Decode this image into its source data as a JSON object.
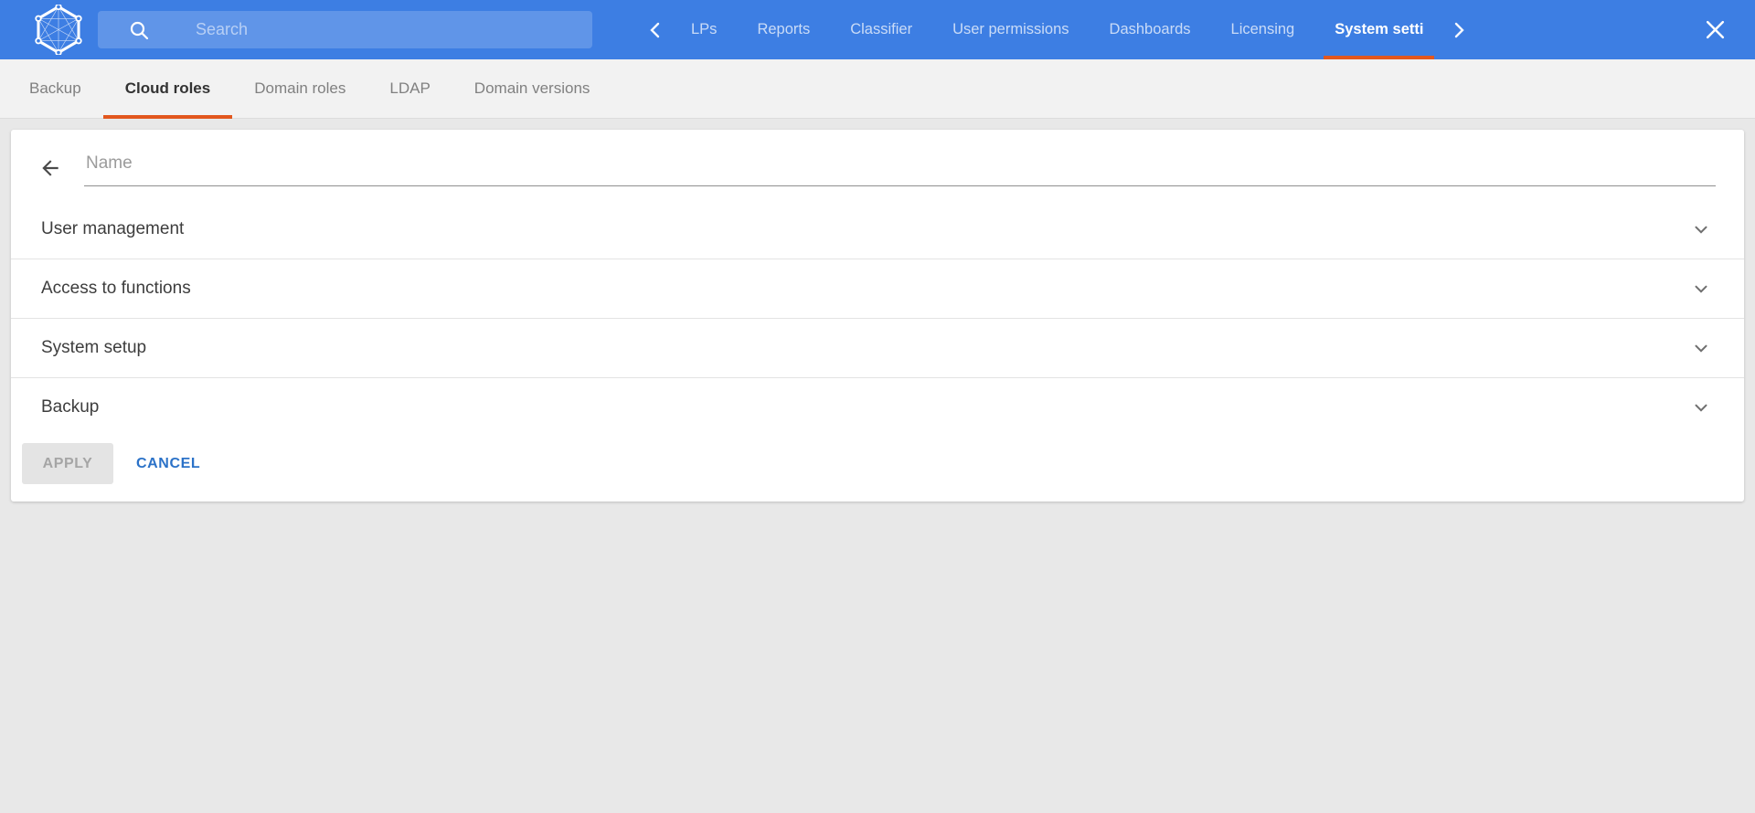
{
  "topbar": {
    "search": {
      "placeholder": "Search",
      "value": ""
    },
    "nav_items": [
      {
        "label": "LPs",
        "active": false
      },
      {
        "label": "Reports",
        "active": false
      },
      {
        "label": "Classifier",
        "active": false
      },
      {
        "label": "User permissions",
        "active": false
      },
      {
        "label": "Dashboards",
        "active": false
      },
      {
        "label": "Licensing",
        "active": false
      },
      {
        "label": "System setti",
        "active": true
      }
    ]
  },
  "subtabs": {
    "items": [
      {
        "label": "Backup",
        "active": false
      },
      {
        "label": "Cloud roles",
        "active": true
      },
      {
        "label": "Domain roles",
        "active": false
      },
      {
        "label": "LDAP",
        "active": false
      },
      {
        "label": "Domain versions",
        "active": false
      }
    ]
  },
  "panel": {
    "name_field": {
      "placeholder": "Name",
      "value": ""
    },
    "sections": [
      {
        "label": "User management",
        "expanded": false
      },
      {
        "label": "Access to functions",
        "expanded": false
      },
      {
        "label": "System setup",
        "expanded": false
      },
      {
        "label": "Backup",
        "expanded": false
      }
    ],
    "apply_label": "APPLY",
    "cancel_label": "CANCEL"
  },
  "colors": {
    "topbar_blue": "#3d7ee3",
    "accent_orange": "#e2571e",
    "cancel_blue": "#2b72c8",
    "tabrow_bg": "#f2f2f2",
    "page_bg": "#e8e8e8"
  }
}
